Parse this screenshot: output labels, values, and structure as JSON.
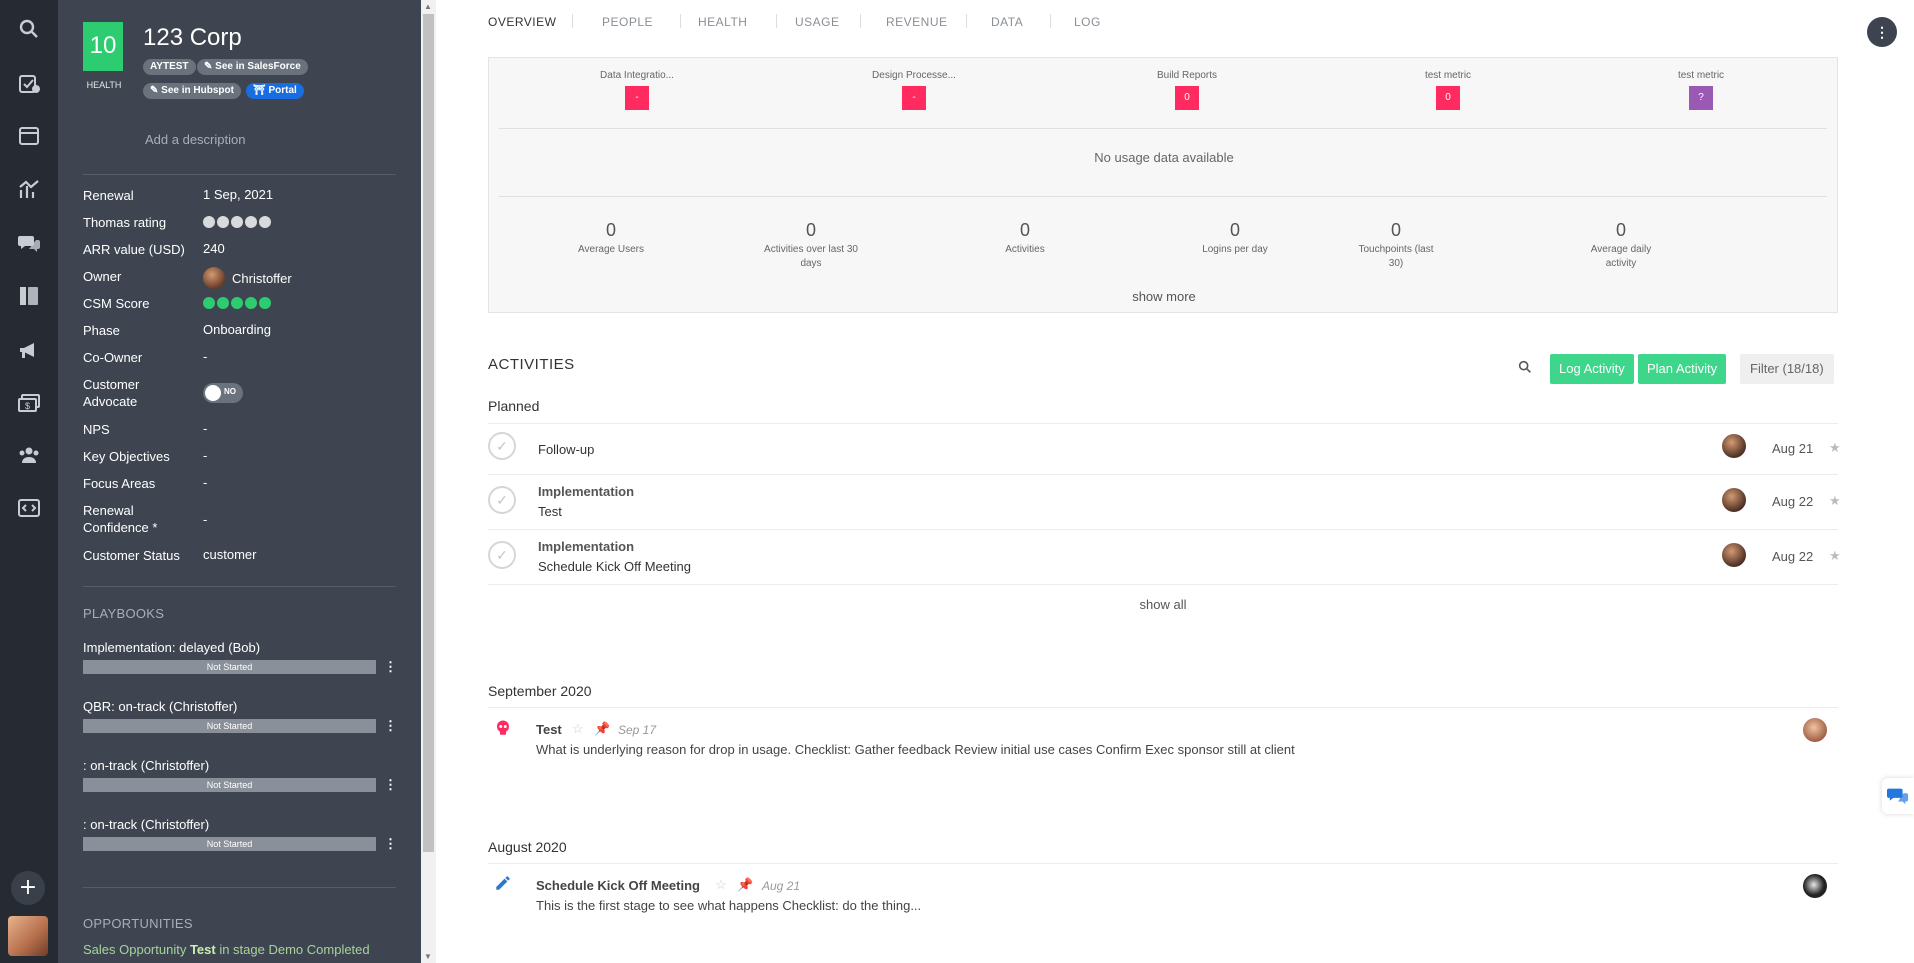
{
  "account": {
    "health_score": "10",
    "health_label": "HEALTH",
    "name": "123 Corp",
    "tags": [
      "AYTEST",
      "✎ See in SalesForce",
      "✎ See in Hubspot"
    ],
    "portal_label": "Portal",
    "description_placeholder": "Add a description"
  },
  "fields": {
    "renewal": {
      "label": "Renewal",
      "value": "1 Sep, 2021"
    },
    "thomas_rating": {
      "label": "Thomas rating",
      "value": 0,
      "max": 5
    },
    "arr": {
      "label": "ARR value (USD)",
      "value": "240"
    },
    "owner": {
      "label": "Owner",
      "value": "Christoffer"
    },
    "csm_score": {
      "label": "CSM Score",
      "value": 5,
      "max": 5
    },
    "phase": {
      "label": "Phase",
      "value": "Onboarding"
    },
    "co_owner": {
      "label": "Co-Owner",
      "value": "-"
    },
    "customer_advocate": {
      "label": "Customer Advocate",
      "toggle": "NO"
    },
    "nps": {
      "label": "NPS",
      "value": "-"
    },
    "key_objectives": {
      "label": "Key Objectives",
      "value": "-"
    },
    "focus_areas": {
      "label": "Focus Areas",
      "value": "-"
    },
    "renewal_confidence": {
      "label": "Renewal Confidence *",
      "value": "-"
    },
    "customer_status": {
      "label": "Customer Status",
      "value": "customer"
    }
  },
  "playbooks": {
    "heading": "PLAYBOOKS",
    "items": [
      {
        "name": "Implementation: delayed (Bob)",
        "status": "Not Started"
      },
      {
        "name": "QBR: on-track (Christoffer)",
        "status": "Not Started"
      },
      {
        "name": ": on-track (Christoffer)",
        "status": "Not Started"
      },
      {
        "name": ": on-track (Christoffer)",
        "status": "Not Started"
      }
    ]
  },
  "opportunities": {
    "heading": "OPPORTUNITIES",
    "prefix": "Sales Opportunity ",
    "name": "Test",
    "suffix": " in stage Demo Completed"
  },
  "tabs": [
    "OVERVIEW",
    "PEOPLE",
    "HEALTH",
    "USAGE",
    "REVENUE",
    "DATA",
    "LOG"
  ],
  "more_label": "⋮",
  "usage": {
    "metrics": [
      {
        "title": "Data Integratio...",
        "badge": "-"
      },
      {
        "title": "Design Processe...",
        "badge": "-"
      },
      {
        "title": "Build Reports",
        "badge": "0"
      },
      {
        "title": "test metric",
        "badge": "0"
      },
      {
        "title": "test metric",
        "badge": "?"
      }
    ],
    "empty_text": "No usage data available",
    "stats": [
      {
        "value": "0",
        "label": "Average Users"
      },
      {
        "value": "0",
        "label": "Activities over last 30 days"
      },
      {
        "value": "0",
        "label": "Activities"
      },
      {
        "value": "0",
        "label": "Logins per day"
      },
      {
        "value": "0",
        "label": "Touchpoints (last 30)"
      },
      {
        "value": "0",
        "label": "Average daily activity"
      }
    ],
    "show_more": "show more"
  },
  "activities": {
    "title": "ACTIVITIES",
    "log_label": "Log Activity",
    "plan_label": "Plan Activity",
    "filter_label": "Filter (18/18)",
    "planned_heading": "Planned",
    "planned": [
      {
        "type": "Follow-up",
        "detail": "",
        "date": "Aug 21"
      },
      {
        "type": "Implementation",
        "detail": "Test",
        "date": "Aug 22"
      },
      {
        "type": "Implementation",
        "detail": "Schedule Kick Off Meeting",
        "date": "Aug 22"
      }
    ],
    "show_all": "show all"
  },
  "timeline": [
    {
      "month": "September 2020",
      "title": "Test",
      "date": "Sep 17",
      "body": "What is underlying reason for drop in usage. Checklist: Gather feedback Review initial use cases Confirm Exec sponsor still at client"
    },
    {
      "month": "August 2020",
      "title": "Schedule Kick Off Meeting",
      "date": "Aug 21",
      "body": "This is the first stage to see what happens Checklist: do the thing..."
    }
  ],
  "colors": {
    "health_green": "#2ecc71",
    "badge_red": "#ff2a5f",
    "badge_purple": "#9b59b6",
    "action_green": "#3ed68a",
    "portal_blue": "#1a6de0"
  }
}
